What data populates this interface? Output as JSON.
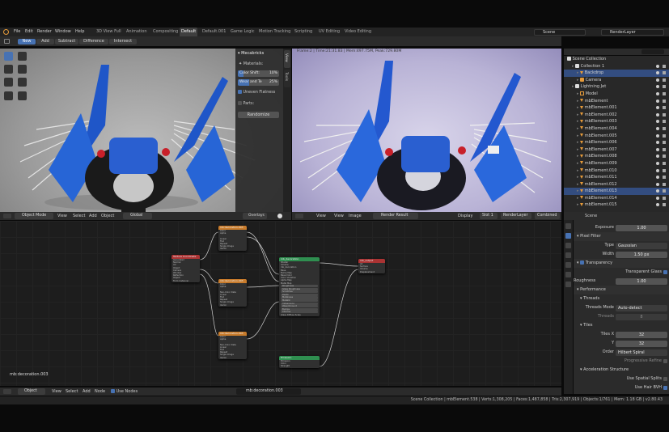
{
  "menus": [
    "File",
    "Edit",
    "Render",
    "Window",
    "Help"
  ],
  "workspaces": [
    "3D View Full",
    "Animation",
    "Compositing",
    "Default",
    "Default.001",
    "Game Logic",
    "Motion Tracking",
    "Scripting",
    "UV Editing",
    "Video Editing"
  ],
  "active_workspace": "Default",
  "scene_name": "Scene",
  "render_layer": "RenderLayer",
  "boolean_bar": {
    "new": "New",
    "add": "Add",
    "subtract": "Subtract",
    "difference": "Difference",
    "intersect": "Intersect"
  },
  "viewport_left": {
    "mode": "Object Mode",
    "view": "View",
    "select": "Select",
    "add": "Add",
    "object": "Object",
    "orientation": "Global",
    "overlays": "Overlays"
  },
  "npanel": {
    "title": "Mecabricks",
    "materials_label": "Materials:",
    "color_shift_label": "Color Shift:",
    "color_shift_value": "10%",
    "wear_label": "Wear and Te",
    "wear_value": "25%",
    "uneven_label": "Uneven Flatness",
    "parts_label": "Parts:",
    "randomize_label": "Randomize",
    "tab_view": "View",
    "tab_tools": "Tools"
  },
  "render_view": {
    "info": "Frame:2 | Time:21:31.83 | Mem:497.75M, Peak:729.80M",
    "view": "View",
    "view2": "View",
    "image": "Image",
    "result": "Render Result",
    "display": "Display",
    "slot": "Slot 1",
    "layer": "RenderLayer",
    "pass": "Combined"
  },
  "outliner": {
    "root": "Scene Collection",
    "rows": [
      {
        "name": "Collection 1",
        "indent": 1,
        "type": "collection",
        "sel": false
      },
      {
        "name": "Backdrop",
        "indent": 2,
        "type": "mesh",
        "sel": true
      },
      {
        "name": "Camera",
        "indent": 2,
        "type": "camera",
        "sel": false
      },
      {
        "name": "Lightning Jet",
        "indent": 1,
        "type": "collection",
        "sel": false
      },
      {
        "name": "Model",
        "indent": 2,
        "type": "empty",
        "sel": false
      },
      {
        "name": "mbElement",
        "indent": 2,
        "type": "mesh",
        "sel": false
      },
      {
        "name": "mbElement.001",
        "indent": 2,
        "type": "mesh",
        "sel": false
      },
      {
        "name": "mbElement.002",
        "indent": 2,
        "type": "mesh",
        "sel": false
      },
      {
        "name": "mbElement.003",
        "indent": 2,
        "type": "mesh",
        "sel": false
      },
      {
        "name": "mbElement.004",
        "indent": 2,
        "type": "mesh",
        "sel": false
      },
      {
        "name": "mbElement.005",
        "indent": 2,
        "type": "mesh",
        "sel": false
      },
      {
        "name": "mbElement.006",
        "indent": 2,
        "type": "mesh",
        "sel": false
      },
      {
        "name": "mbElement.007",
        "indent": 2,
        "type": "mesh",
        "sel": false
      },
      {
        "name": "mbElement.008",
        "indent": 2,
        "type": "mesh",
        "sel": false
      },
      {
        "name": "mbElement.009",
        "indent": 2,
        "type": "mesh",
        "sel": false
      },
      {
        "name": "mbElement.010",
        "indent": 2,
        "type": "mesh",
        "sel": false
      },
      {
        "name": "mbElement.011",
        "indent": 2,
        "type": "mesh",
        "sel": false
      },
      {
        "name": "mbElement.012",
        "indent": 2,
        "type": "mesh",
        "sel": false
      },
      {
        "name": "mbElement.013",
        "indent": 2,
        "type": "mesh",
        "sel": true
      },
      {
        "name": "mbElement.014",
        "indent": 2,
        "type": "mesh",
        "sel": false
      },
      {
        "name": "mbElement.015",
        "indent": 2,
        "type": "mesh",
        "sel": false
      }
    ]
  },
  "properties": {
    "context": "Scene",
    "exposure_label": "Exposure",
    "exposure_value": "1.00",
    "pixel_filter_label": "Pixel Filter",
    "type_label": "Type",
    "type_value": "Gaussian",
    "width_label": "Width",
    "width_value": "1.50 px",
    "transparency_label": "Transparency",
    "transparent_glass_label": "Transparent Glass",
    "roughness_threshold_label": "Roughness Threshold",
    "roughness_threshold_value": "1.00",
    "performance_label": "Performance",
    "threads_label": "Threads",
    "threads_mode_label": "Threads Mode",
    "threads_mode_value": "Auto-detect",
    "threads_count_label": "Threads",
    "threads_count_value": "8",
    "tiles_label": "Tiles",
    "tiles_x_label": "Tiles X",
    "tiles_x_value": "32",
    "tiles_y_label": "Y",
    "tiles_y_value": "32",
    "order_label": "Order",
    "order_value": "Hilbert Spiral",
    "progressive_label": "Progressive Refine",
    "accel_label": "Acceleration Structure",
    "spatial_label": "Use Spatial Splits",
    "hair_bvh_label": "Use Hair BVH"
  },
  "node_editor": {
    "material_label": "mb:decoration.003",
    "header_object": "Object",
    "view": "View",
    "select": "Select",
    "add": "Add",
    "node": "Node",
    "use_nodes": "Use Nodes",
    "material_field": "mb:decoration.003",
    "nodes": {
      "texcoord": {
        "title": "Texture Coordinate",
        "rows": [
          "Generated",
          "Normal",
          "UV",
          "Object",
          "Camera",
          "Window",
          "Reflection",
          "Object:",
          "From Instancer"
        ]
      },
      "img1": {
        "title": "mb:decoration.003",
        "rows": [
          "Color",
          "Alpha",
          "",
          "Linear",
          "Flat",
          "Repeat",
          "Single Image",
          "Vector"
        ]
      },
      "img2": {
        "title": "mb:decoration.003",
        "rows": [
          "Color",
          "Alpha",
          "",
          "Non-Color Data",
          "Linear",
          "Flat",
          "Repeat",
          "Single Image",
          "Vector"
        ]
      },
      "img3": {
        "title": "mb:decoration.003",
        "rows": [
          "Color",
          "Alpha",
          "",
          "Non-Color Data",
          "Linear",
          "Flat",
          "Repeat",
          "Single Image",
          "Vector"
        ]
      },
      "shader": {
        "title": "mb_decoration",
        "rows": [
          "Shader",
          "Volume",
          "mb_decoration",
          "Base",
          "Bump Map",
          "Base Color",
          "Color Variation",
          "Alpha Map",
          "Metal Map",
          "Roughness",
          "Glass Roughness",
          "Scratches",
          "Dents",
          "Metalness",
          "Metallic",
          "Iridescence",
          "Wear/Amount",
          "Bumps",
          "Chrome",
          "Glass Diffuse Scale"
        ]
      },
      "output": {
        "title": "mb_output",
        "rows": [
          "All",
          "Surface",
          "Volume",
          "Displacement"
        ]
      },
      "emission": {
        "title": "Emission",
        "rows": [
          "Emission",
          "Color",
          "Strength"
        ]
      }
    }
  },
  "status": {
    "text": "Scene Collection | mbElement.538 | Verts:1,308,205 | Faces:1,487,858 | Tris:2,307,919 | Objects:1/761 | Mem: 1.18 GB | v2.80.43"
  },
  "colors": {
    "accent": "#4772b3",
    "selection": "#334d80",
    "orange": "#e69b3a"
  }
}
